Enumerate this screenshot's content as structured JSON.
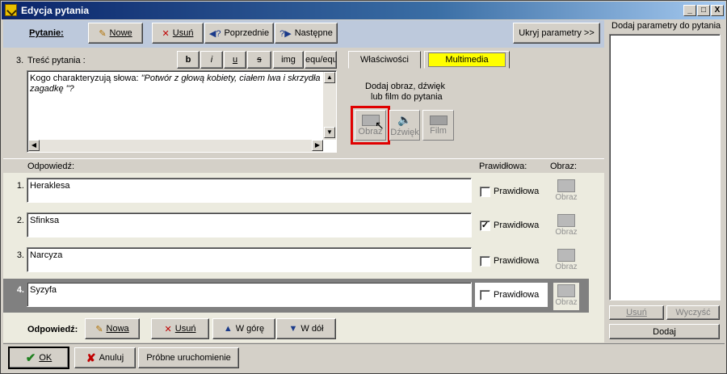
{
  "window": {
    "title": "Edycja pytania",
    "controls": [
      "_",
      "□",
      "X"
    ]
  },
  "toolbar": {
    "label": "Pytanie:",
    "new": "Nowe",
    "delete": "Usuń",
    "previous": "Poprzednie",
    "next": "Następne",
    "hide_params": "Ukryj parametry >>"
  },
  "question": {
    "number": "3.",
    "label": "Treść pytania :",
    "format_buttons": [
      "b",
      "i",
      "u",
      "s",
      "img",
      "equ/equ"
    ],
    "text_plain": "Kogo charakteryzują słowa: ",
    "text_italic": "\"Potwór z głową kobiety, ciałem lwa i skrzydła",
    "text_line2": "zagadkę \"?"
  },
  "tabs": {
    "properties": "Właściwości",
    "multimedia": "Multimedia"
  },
  "multimedia": {
    "hint_line1": "Dodaj  obraz, dźwięk",
    "hint_line2": "lub film do pytania",
    "image": "Obraz",
    "sound": "Dźwięk",
    "film": "Film",
    "highlight_color": "#e00000"
  },
  "answers_header": {
    "answer": "Odpowiedź:",
    "correct": "Prawidłowa:",
    "image": "Obraz:"
  },
  "answers": [
    {
      "num": "1.",
      "text": "Heraklesa",
      "correct_label": "Prawidłowa",
      "correct": false,
      "image": "Obraz"
    },
    {
      "num": "2.",
      "text": "Sfinksa",
      "correct_label": "Prawidłowa",
      "correct": true,
      "image": "Obraz"
    },
    {
      "num": "3.",
      "text": "Narcyza",
      "correct_label": "Prawidłowa",
      "correct": false,
      "image": "Obraz"
    },
    {
      "num": "4.",
      "text": "Syzyfa",
      "correct_label": "Prawidłowa",
      "correct": false,
      "image": "Obraz"
    }
  ],
  "answer_toolbar": {
    "label": "Odpowiedź:",
    "new": "Nowa",
    "delete": "Usuń",
    "up": "W górę",
    "down": "W dół"
  },
  "footer": {
    "ok": "OK",
    "cancel": "Anuluj",
    "test_run": "Próbne uruchomienie"
  },
  "params_panel": {
    "title": "Dodaj parametry do pytania",
    "delete": "Usuń",
    "clear": "Wyczyść",
    "add": "Dodaj"
  },
  "colors": {
    "toolbar_bg": "#bdc9dc",
    "answers_bg": "#ecebdf",
    "multimedia_tab": "#ffff00",
    "selected_row": "#808080"
  }
}
